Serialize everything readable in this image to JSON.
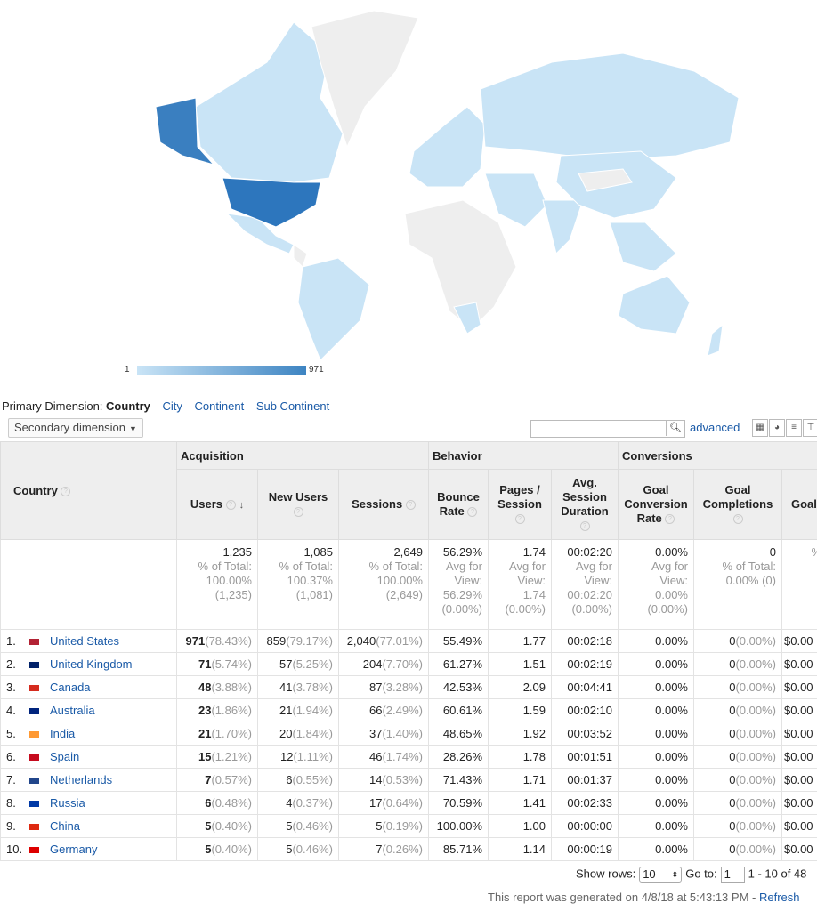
{
  "map": {
    "legend_min": "1",
    "legend_max": "971",
    "colors": {
      "low": "#c9e4f6",
      "high": "#3d84c2",
      "none": "#eeeeee",
      "top": "#3a7fc0"
    }
  },
  "primary_dimension": {
    "label": "Primary Dimension:",
    "active": "Country",
    "options": [
      "City",
      "Continent",
      "Sub Continent"
    ]
  },
  "secondary_dimension": "Secondary dimension",
  "search": {
    "value": ""
  },
  "advanced_label": "advanced",
  "table": {
    "groups": [
      "Acquisition",
      "Behavior",
      "Conversions"
    ],
    "country_header": "Country",
    "columns": [
      "Users",
      "New Users",
      "Sessions",
      "Bounce Rate",
      "Pages / Session",
      "Avg. Session Duration",
      "Goal Conversion Rate",
      "Goal Completions",
      "Goal"
    ],
    "totals": [
      {
        "main": "1,235",
        "sub": [
          "% of Total:",
          "100.00%",
          "(1,235)"
        ]
      },
      {
        "main": "1,085",
        "sub": [
          "% of Total:",
          "100.37%",
          "(1,081)"
        ]
      },
      {
        "main": "2,649",
        "sub": [
          "% of Total:",
          "100.00%",
          "(2,649)"
        ]
      },
      {
        "main": "56.29%",
        "sub": [
          "Avg for",
          "View:",
          "56.29%",
          "(0.00%)"
        ]
      },
      {
        "main": "1.74",
        "sub": [
          "Avg for",
          "View:",
          "1.74",
          "(0.00%)"
        ]
      },
      {
        "main": "00:02:20",
        "sub": [
          "Avg for",
          "View:",
          "00:02:20",
          "(0.00%)"
        ]
      },
      {
        "main": "0.00%",
        "sub": [
          "Avg for",
          "View:",
          "0.00%",
          "(0.00%)"
        ]
      },
      {
        "main": "0",
        "sub": [
          "% of Total:",
          "0.00% (0)"
        ]
      },
      {
        "main": "",
        "sub": [
          "% o"
        ]
      }
    ],
    "rows": [
      {
        "idx": "1.",
        "country": "United States",
        "users": "971",
        "users_pct": "(78.43%)",
        "new_users": "859",
        "new_users_pct": "(79.17%)",
        "sessions": "2,040",
        "sessions_pct": "(77.01%)",
        "bounce": "55.49%",
        "pages": "1.77",
        "duration": "00:02:18",
        "conv_rate": "0.00%",
        "completions": "0",
        "completions_pct": "(0.00%)",
        "goal": "$0.00"
      },
      {
        "idx": "2.",
        "country": "United Kingdom",
        "users": "71",
        "users_pct": "(5.74%)",
        "new_users": "57",
        "new_users_pct": "(5.25%)",
        "sessions": "204",
        "sessions_pct": "(7.70%)",
        "bounce": "61.27%",
        "pages": "1.51",
        "duration": "00:02:19",
        "conv_rate": "0.00%",
        "completions": "0",
        "completions_pct": "(0.00%)",
        "goal": "$0.00"
      },
      {
        "idx": "3.",
        "country": "Canada",
        "users": "48",
        "users_pct": "(3.88%)",
        "new_users": "41",
        "new_users_pct": "(3.78%)",
        "sessions": "87",
        "sessions_pct": "(3.28%)",
        "bounce": "42.53%",
        "pages": "2.09",
        "duration": "00:04:41",
        "conv_rate": "0.00%",
        "completions": "0",
        "completions_pct": "(0.00%)",
        "goal": "$0.00"
      },
      {
        "idx": "4.",
        "country": "Australia",
        "users": "23",
        "users_pct": "(1.86%)",
        "new_users": "21",
        "new_users_pct": "(1.94%)",
        "sessions": "66",
        "sessions_pct": "(2.49%)",
        "bounce": "60.61%",
        "pages": "1.59",
        "duration": "00:02:10",
        "conv_rate": "0.00%",
        "completions": "0",
        "completions_pct": "(0.00%)",
        "goal": "$0.00"
      },
      {
        "idx": "5.",
        "country": "India",
        "users": "21",
        "users_pct": "(1.70%)",
        "new_users": "20",
        "new_users_pct": "(1.84%)",
        "sessions": "37",
        "sessions_pct": "(1.40%)",
        "bounce": "48.65%",
        "pages": "1.92",
        "duration": "00:03:52",
        "conv_rate": "0.00%",
        "completions": "0",
        "completions_pct": "(0.00%)",
        "goal": "$0.00"
      },
      {
        "idx": "6.",
        "country": "Spain",
        "users": "15",
        "users_pct": "(1.21%)",
        "new_users": "12",
        "new_users_pct": "(1.11%)",
        "sessions": "46",
        "sessions_pct": "(1.74%)",
        "bounce": "28.26%",
        "pages": "1.78",
        "duration": "00:01:51",
        "conv_rate": "0.00%",
        "completions": "0",
        "completions_pct": "(0.00%)",
        "goal": "$0.00"
      },
      {
        "idx": "7.",
        "country": "Netherlands",
        "users": "7",
        "users_pct": "(0.57%)",
        "new_users": "6",
        "new_users_pct": "(0.55%)",
        "sessions": "14",
        "sessions_pct": "(0.53%)",
        "bounce": "71.43%",
        "pages": "1.71",
        "duration": "00:01:37",
        "conv_rate": "0.00%",
        "completions": "0",
        "completions_pct": "(0.00%)",
        "goal": "$0.00"
      },
      {
        "idx": "8.",
        "country": "Russia",
        "users": "6",
        "users_pct": "(0.48%)",
        "new_users": "4",
        "new_users_pct": "(0.37%)",
        "sessions": "17",
        "sessions_pct": "(0.64%)",
        "bounce": "70.59%",
        "pages": "1.41",
        "duration": "00:02:33",
        "conv_rate": "0.00%",
        "completions": "0",
        "completions_pct": "(0.00%)",
        "goal": "$0.00"
      },
      {
        "idx": "9.",
        "country": "China",
        "users": "5",
        "users_pct": "(0.40%)",
        "new_users": "5",
        "new_users_pct": "(0.46%)",
        "sessions": "5",
        "sessions_pct": "(0.19%)",
        "bounce": "100.00%",
        "pages": "1.00",
        "duration": "00:00:00",
        "conv_rate": "0.00%",
        "completions": "0",
        "completions_pct": "(0.00%)",
        "goal": "$0.00"
      },
      {
        "idx": "10.",
        "country": "Germany",
        "users": "5",
        "users_pct": "(0.40%)",
        "new_users": "5",
        "new_users_pct": "(0.46%)",
        "sessions": "7",
        "sessions_pct": "(0.26%)",
        "bounce": "85.71%",
        "pages": "1.14",
        "duration": "00:00:19",
        "conv_rate": "0.00%",
        "completions": "0",
        "completions_pct": "(0.00%)",
        "goal": "$0.00"
      }
    ],
    "flag_colors": [
      "#b22234",
      "#012169",
      "#d52b1e",
      "#00247d",
      "#ff9933",
      "#c60b1e",
      "#21468b",
      "#0039a6",
      "#de2910",
      "#dd0000"
    ]
  },
  "pagination": {
    "show_rows_label": "Show rows:",
    "rows_value": "10",
    "goto_label": "Go to:",
    "goto_value": "1",
    "range": "1 - 10 of 48"
  },
  "generated": {
    "text": "This report was generated on 4/8/18 at 5:43:13 PM -",
    "refresh": "Refresh"
  }
}
